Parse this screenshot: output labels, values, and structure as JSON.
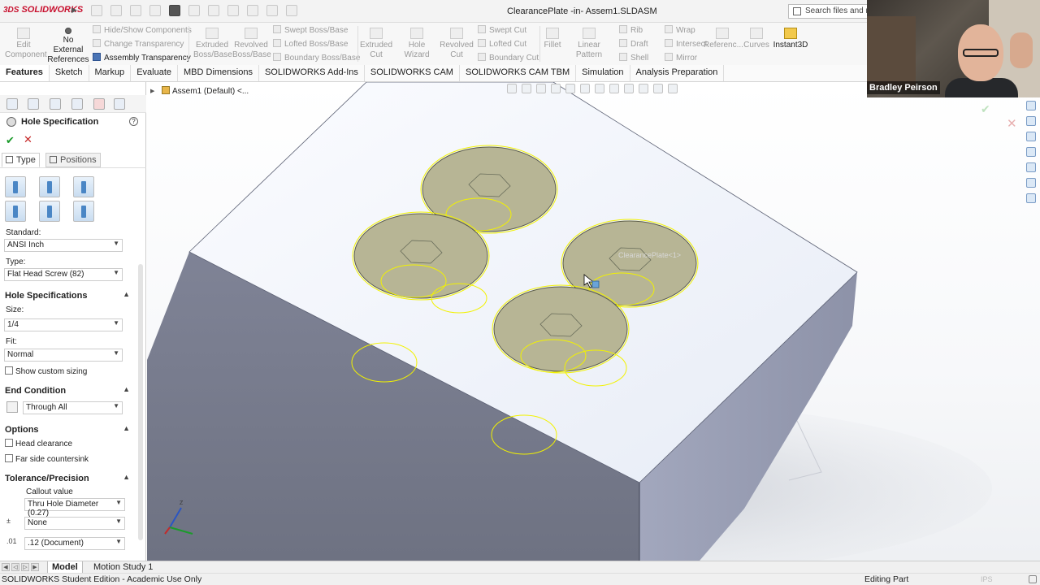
{
  "titlebar": {
    "logo_ds": "3DS",
    "logo": "SOLIDWORKS",
    "title": "ClearancePlate -in- Assem1.SLDASM",
    "search_placeholder": "Search files and models"
  },
  "command_manager": {
    "edit_component": "Edit\nComponent",
    "no_external_references": "No External\nReferences",
    "hide_show_components": "Hide/Show Components",
    "change_transparency": "Change Transparency",
    "assembly_transparency": "Assembly Transparency",
    "extruded_boss": "Extruded\nBoss/Base",
    "revolved_boss": "Revolved\nBoss/Base",
    "swept_boss": "Swept Boss/Base",
    "lofted_boss": "Lofted Boss/Base",
    "boundary_boss": "Boundary Boss/Base",
    "extruded_cut": "Extruded\nCut",
    "hole_wizard": "Hole Wizard",
    "revolved_cut": "Revolved\nCut",
    "swept_cut": "Swept Cut",
    "lofted_cut": "Lofted Cut",
    "boundary_cut": "Boundary Cut",
    "fillet": "Fillet",
    "linear_pattern": "Linear Pattern",
    "rib": "Rib",
    "draft": "Draft",
    "shell": "Shell",
    "wrap": "Wrap",
    "intersect": "Intersect",
    "mirror": "Mirror",
    "reference": "Referenc...",
    "curves": "Curves",
    "instant3d": "Instant3D"
  },
  "tabs": [
    "Features",
    "Sketch",
    "Markup",
    "Evaluate",
    "MBD Dimensions",
    "SOLIDWORKS Add-Ins",
    "SOLIDWORKS CAM",
    "SOLIDWORKS CAM TBM",
    "Simulation",
    "Analysis Preparation"
  ],
  "property_manager": {
    "title": "Hole Specification",
    "help": "?",
    "ok": "✔",
    "cancel": "✕",
    "tab_type": "Type",
    "tab_positions": "Positions",
    "standard_label": "Standard:",
    "standard_value": "ANSI Inch",
    "type_label": "Type:",
    "type_value": "Flat Head Screw (82)",
    "hole_specs_header": "Hole Specifications",
    "size_label": "Size:",
    "size_value": "1/4",
    "fit_label": "Fit:",
    "fit_value": "Normal",
    "show_custom_sizing": "Show custom sizing",
    "end_condition_header": "End Condition",
    "end_condition_value": "Through All",
    "options_header": "Options",
    "head_clearance": "Head clearance",
    "far_side_countersink": "Far side countersink",
    "tolerance_header": "Tolerance/Precision",
    "callout_value_label": "Callout value",
    "callout_value": "Thru Hole Diameter (0.27)",
    "tolerance_value": "None",
    "precision_value": ".12 (Document)"
  },
  "viewport": {
    "tree_label": "Assem1 (Default) <...",
    "ghost_text": "ClearancePlate<1>"
  },
  "webcam": {
    "name": "Bradley Peirson"
  },
  "bottom_tabs": {
    "model": "Model",
    "motion": "Motion Study 1"
  },
  "status": {
    "left": "SOLIDWORKS Student Edition - Academic Use Only",
    "right": "Editing Part",
    "units": "IPS"
  },
  "colors": {
    "brand_red": "#c8102e",
    "part_top": "#f4f7fd",
    "part_side_left": "#8a8fa0",
    "part_side_right": "#9da2b8",
    "hole_fill": "#b9b89a",
    "preview_yellow": "#f2f200"
  }
}
